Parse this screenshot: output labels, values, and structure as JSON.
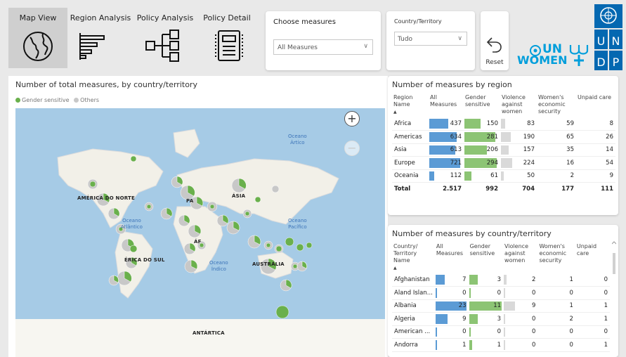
{
  "nav": {
    "map_view": "Map View",
    "region_analysis": "Region Analysis",
    "policy_analysis": "Policy Analysis",
    "policy_detail": "Policy Detail",
    "icons": [
      "globe-icon",
      "bar-chart-icon",
      "tree-diagram-icon",
      "document-icon"
    ]
  },
  "filters": {
    "measures_title": "Choose measures",
    "measures_value": "All Measures",
    "country_title": "Country/Territory",
    "country_value": "Tudo",
    "reset_label": "Reset"
  },
  "logos": {
    "unwomen_line1": "UN",
    "unwomen_line2": "WOMEN",
    "undp": [
      "U",
      "N",
      "D",
      "P"
    ]
  },
  "map": {
    "title": "Number of total measures, by country/territory",
    "legend_gender": "Gender sensitive",
    "legend_others": "Others",
    "labels": {
      "north_america": "AMÉRICA DO NORTE",
      "south_america": "ÉRICA DO SUL",
      "asia": "ÁSIA",
      "europe": "PA",
      "africa": "ÁF",
      "australia": "AUSTRÁLIA",
      "antarctica": "ANTÁRTICA"
    },
    "oceans": {
      "arctic_1": "Oceano",
      "arctic_2": "Ártico",
      "atlantic_1": "Oceano",
      "atlantic_2": "Atlântico",
      "pacific_1": "Oceano",
      "pacific_2": "Pacífico",
      "indian_1": "Oceano",
      "indian_2": "Índico"
    },
    "colors": {
      "gender": "#6ab04c",
      "others": "#c8c8c8",
      "water": "#a6cbe6",
      "land": "#f2f0e8"
    }
  },
  "region_table": {
    "title": "Number of measures by region",
    "headers": [
      "Region Name",
      "All Measures",
      "Gender sensitive",
      "Violence against women",
      "Women's economic security",
      "Unpaid care"
    ],
    "rows": [
      {
        "name": "Africa",
        "all": 437,
        "gender": 150,
        "violence": 83,
        "economic": 59,
        "unpaid": 8
      },
      {
        "name": "Americas",
        "all": 634,
        "gender": 281,
        "violence": 190,
        "economic": 65,
        "unpaid": 26
      },
      {
        "name": "Asia",
        "all": 613,
        "gender": 206,
        "violence": 157,
        "economic": 35,
        "unpaid": 14
      },
      {
        "name": "Europe",
        "all": 721,
        "gender": 294,
        "violence": 224,
        "economic": 16,
        "unpaid": 54
      },
      {
        "name": "Oceania",
        "all": 112,
        "gender": 61,
        "violence": 50,
        "economic": 2,
        "unpaid": 9
      }
    ],
    "total": {
      "name": "Total",
      "all": "2.517",
      "gender": "992",
      "violence": "704",
      "economic": "177",
      "unpaid": "111"
    }
  },
  "country_table": {
    "title": "Number of measures by country/territory",
    "headers": [
      "Country/ Territory Name",
      "All Measures",
      "Gender sensitive",
      "Violence against women",
      "Women's economic security",
      "Unpaid care"
    ],
    "rows": [
      {
        "name": "Afghanistan",
        "all": 7,
        "gender": 3,
        "violence": 2,
        "economic": 1,
        "unpaid": 0
      },
      {
        "name": "Aland Islan...",
        "all": 0,
        "gender": 0,
        "violence": 0,
        "economic": 0,
        "unpaid": 0
      },
      {
        "name": "Albania",
        "all": 23,
        "gender": 11,
        "violence": 9,
        "economic": 1,
        "unpaid": 1
      },
      {
        "name": "Algeria",
        "all": 9,
        "gender": 3,
        "violence": 0,
        "economic": 2,
        "unpaid": 1
      },
      {
        "name": "American ...",
        "all": 0,
        "gender": 0,
        "violence": 0,
        "economic": 0,
        "unpaid": 0
      },
      {
        "name": "Andorra",
        "all": 1,
        "gender": 1,
        "violence": 0,
        "economic": 0,
        "unpaid": 1
      }
    ]
  }
}
